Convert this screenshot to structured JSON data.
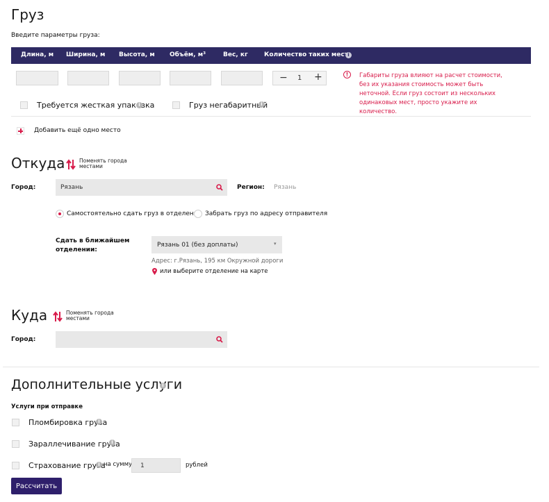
{
  "cargo": {
    "title": "Груз",
    "subtitle": "Введите параметры груза:",
    "columns": [
      "Длина, м",
      "Ширина, м",
      "Высота, м",
      "Объём, м³",
      "Вес, кг",
      "Количество таких мест"
    ],
    "quantity": {
      "minus": "−",
      "value": "1",
      "plus": "+"
    },
    "warning": "Габариты груза влияют на расчет стоимости, без их указания стоимость может быть неточной. Если груз состоит из нескольких одинаковых мест, просто укажите их количество.",
    "rigid_packaging": "Требуется жесткая упаковка",
    "oversized": "Груз негабаритный",
    "add_place": "Добавить ещё одно место"
  },
  "from": {
    "title": "Откуда",
    "swap": "Поменять города местами",
    "city_label": "Город:",
    "city_value": "Рязань",
    "region_label": "Регион:",
    "region_value": "Рязань",
    "radio_self": "Самостоятельно сдать груз в отделении",
    "radio_pickup": "Забрать груз по адресу отправителя",
    "branch_label": "Сдать в ближайшем отделении:",
    "branch_selected": "Рязань 01 (без доплаты)",
    "address": "Адрес: г.Рязань, 195 км Окружной дороги",
    "map_link": "или выберите отделение на карте"
  },
  "to": {
    "title": "Куда",
    "swap": "Поменять города местами",
    "city_label": "Город:"
  },
  "extra": {
    "title": "Дополнительные услуги",
    "section": "Услуги при отправке",
    "sealing": "Пломбировка груза",
    "palletizing": "Заpaллечивание груза",
    "insurance": "Страхование груза",
    "for_sum": "на сумму",
    "insurance_value": "1",
    "currency": "рублей"
  },
  "calculate": "Рассчитать",
  "colors": {
    "header": "#2e2a63",
    "accent": "#d81b4a",
    "button": "#2e1f6b"
  }
}
